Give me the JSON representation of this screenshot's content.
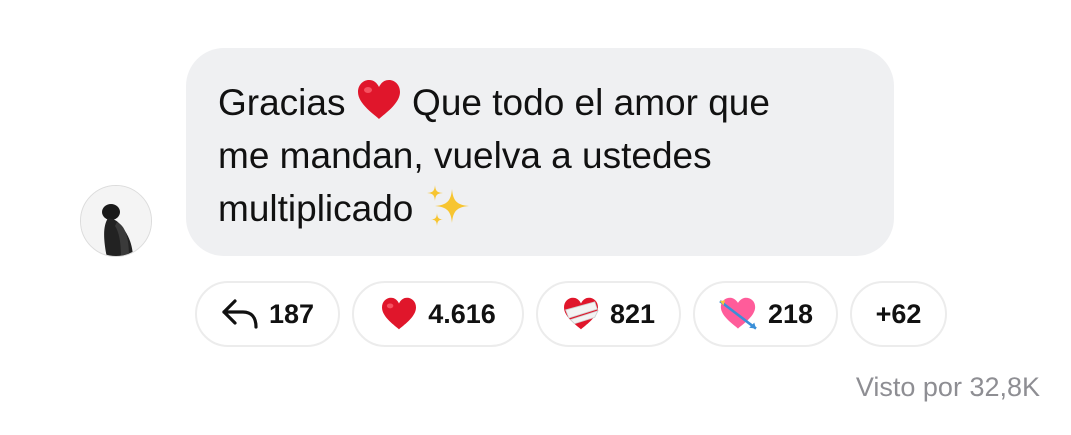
{
  "message": {
    "line1_part1": "Gracias",
    "line1_emoji": "red-heart",
    "line1_part2": "Que todo el amor que",
    "line2": "me mandan, vuelva a ustedes",
    "line3": "multiplicado",
    "line3_emoji": "sparkles"
  },
  "reactions": {
    "replies": {
      "icon": "reply-icon",
      "count": "187"
    },
    "heart": {
      "icon": "red-heart-icon",
      "count": "4.616"
    },
    "mending_heart": {
      "icon": "mending-heart-icon",
      "count": "821"
    },
    "heart_arrow": {
      "icon": "heart-with-arrow-icon",
      "count": "218"
    },
    "more": {
      "label": "+62"
    }
  },
  "seen_by": "Visto por 32,8K",
  "colors": {
    "bubble_bg": "#eff0f2",
    "text": "#111111",
    "muted": "#8e8e93",
    "pill_border": "#ececec",
    "heart": "#e0162b"
  }
}
